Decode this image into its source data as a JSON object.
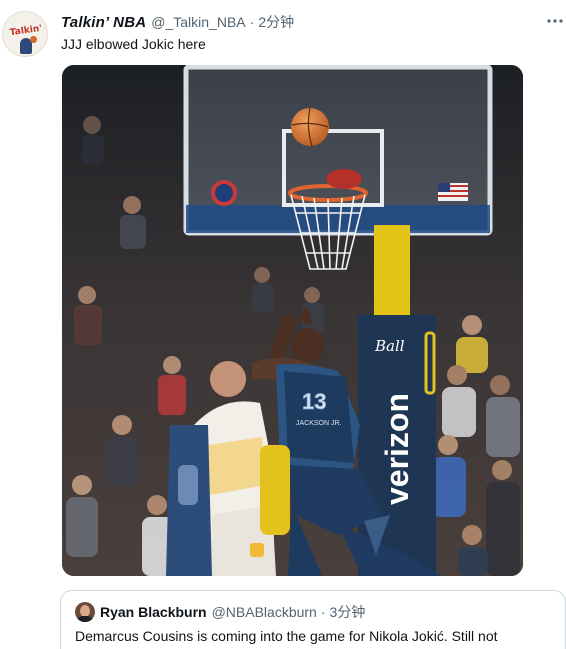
{
  "tweet": {
    "display_name": "Talkin’ NBA",
    "handle": "@_Talkin_NBA",
    "separator": "·",
    "time": "2分钟",
    "text": "JJJ elbowed Jokic here",
    "avatar_text": "Talkin'",
    "more_icon": "more-horizontal-icon"
  },
  "media": {
    "jersey_number": "13",
    "jersey_name": "JACKSON JR.",
    "sponsor_top": "Ball",
    "sponsor_side": "verizon"
  },
  "quote": {
    "display_name": "Ryan Blackburn",
    "handle": "@NBABlackburn",
    "separator": "·",
    "time": "3分钟",
    "text": "Demarcus Cousins is coming into the game for Nikola Jokić. Still not"
  },
  "colors": {
    "text_primary": "#0f1419",
    "text_secondary": "#536471",
    "border": "#cfd9de",
    "grizzlies_navy": "#1d3a5f",
    "verizon_navy": "#1e3553",
    "stanchion_yellow": "#e5c41a"
  }
}
